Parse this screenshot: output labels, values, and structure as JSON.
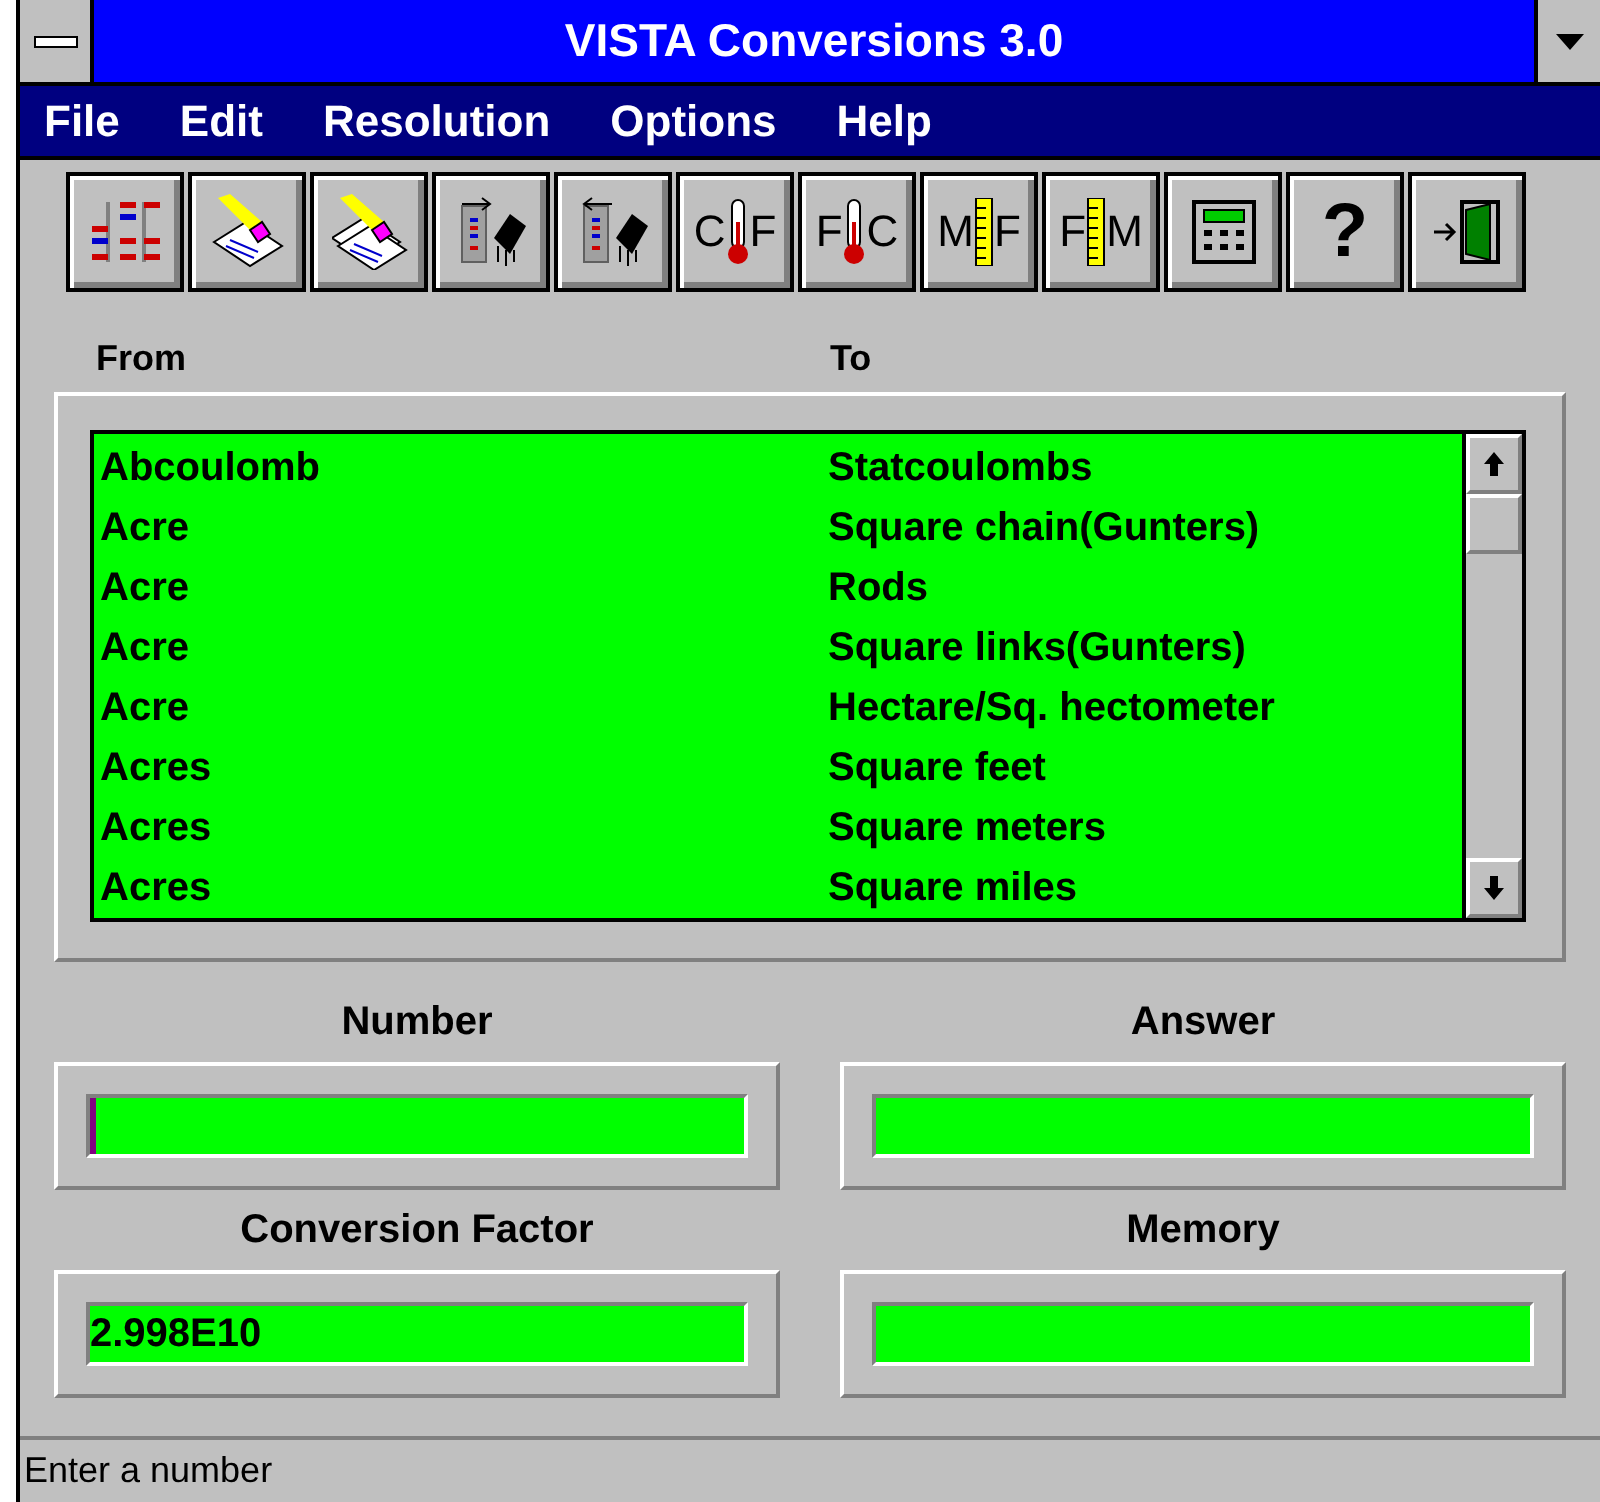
{
  "window": {
    "title": "VISTA Conversions 3.0"
  },
  "menu": [
    "File",
    "Edit",
    "Resolution",
    "Options",
    "Help"
  ],
  "toolbar": [
    {
      "kind": "grid"
    },
    {
      "kind": "eraser"
    },
    {
      "kind": "eraser-double"
    },
    {
      "kind": "chip-right"
    },
    {
      "kind": "chip-left"
    },
    {
      "kind": "thermometer",
      "left": "C",
      "right": "F"
    },
    {
      "kind": "thermometer",
      "left": "F",
      "right": "C"
    },
    {
      "kind": "ruler",
      "left": "M",
      "right": "F"
    },
    {
      "kind": "ruler",
      "left": "F",
      "right": "M"
    },
    {
      "kind": "calculator"
    },
    {
      "kind": "text",
      "label": "?"
    },
    {
      "kind": "door"
    }
  ],
  "list": {
    "columns": [
      "From",
      "To"
    ],
    "rows": [
      [
        "Abcoulomb",
        "Statcoulombs"
      ],
      [
        "Acre",
        "Square chain(Gunters)"
      ],
      [
        "Acre",
        "Rods"
      ],
      [
        "Acre",
        "Square links(Gunters)"
      ],
      [
        "Acre",
        "Hectare/Sq. hectometer"
      ],
      [
        "Acres",
        "Square feet"
      ],
      [
        "Acres",
        "Square meters"
      ],
      [
        "Acres",
        "Square miles"
      ]
    ]
  },
  "fields": [
    {
      "label": "Number",
      "focused": true
    },
    {
      "label": "Answer",
      "focused": false
    },
    {
      "label": "Conversion Factor",
      "value": "2.998E10",
      "focused": false
    },
    {
      "label": "Memory",
      "focused": false
    }
  ],
  "status_bar": "Enter a number"
}
